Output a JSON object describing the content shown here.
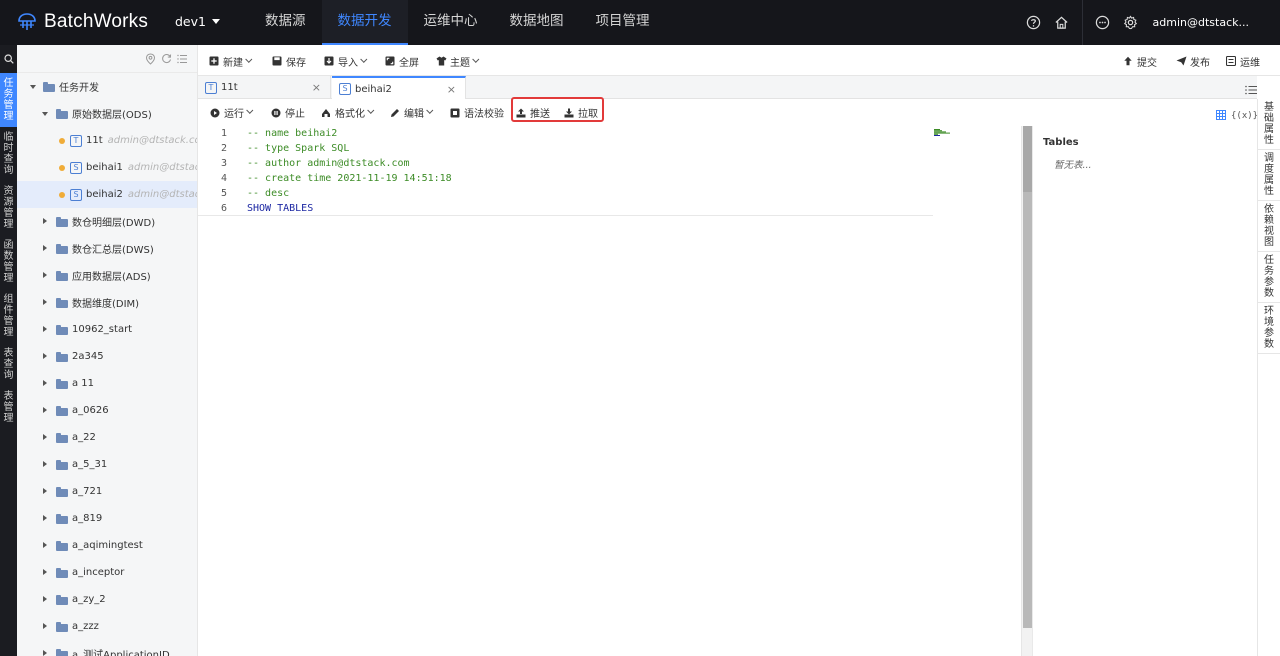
{
  "app": {
    "name": "BatchWorks",
    "project": "dev1"
  },
  "nav": [
    "数据源",
    "数据开发",
    "运维中心",
    "数据地图",
    "项目管理"
  ],
  "nav_active": "数据开发",
  "user": {
    "name": "admin@dtstack..."
  },
  "left_strip": [
    "任务管理",
    "临时查询",
    "资源管理",
    "函数管理",
    "组件管理",
    "表查询",
    "表管理"
  ],
  "tree": {
    "root": "任务开发",
    "ods_folder": "原始数据层(ODS)",
    "files": [
      {
        "type": "T",
        "name": "11t",
        "owner": "admin@dtstack.com"
      },
      {
        "type": "S",
        "name": "beihai1",
        "owner": "admin@dtstack.com"
      },
      {
        "type": "S",
        "name": "beihai2",
        "owner": "admin@dtstack.com"
      }
    ],
    "folders": [
      "数仓明细层(DWD)",
      "数仓汇总层(DWS)",
      "应用数据层(ADS)",
      "数据维度(DIM)",
      "10962_start",
      "2a345",
      "a 11",
      "a_0626",
      "a_22",
      "a_5_31",
      "a_721",
      "a_819",
      "a_aqimingtest",
      "a_inceptor",
      "a_zy_2",
      "a_zzz",
      "a_测试ApplicationID"
    ]
  },
  "main_toolbar": {
    "new": "新建",
    "save": "保存",
    "import": "导入",
    "fullscreen": "全屏",
    "theme": "主题",
    "submit": "提交",
    "publish": "发布",
    "ops": "运维"
  },
  "tabs": [
    {
      "type": "T",
      "name": "11t"
    },
    {
      "type": "S",
      "name": "beihai2"
    }
  ],
  "editor_toolbar": {
    "run": "运行",
    "stop": "停止",
    "format": "格式化",
    "edit": "编辑",
    "syntax": "语法校验",
    "push": "推送",
    "pull": "拉取",
    "vars": "{(x)}"
  },
  "code": [
    {
      "n": "1",
      "text": "-- name beihai2",
      "kind": "comment"
    },
    {
      "n": "2",
      "text": "-- type Spark SQL",
      "kind": "comment"
    },
    {
      "n": "3",
      "text": "-- author admin@dtstack.com",
      "kind": "comment"
    },
    {
      "n": "4",
      "text": "-- create time 2021-11-19 14:51:18",
      "kind": "comment"
    },
    {
      "n": "5",
      "text": "-- desc",
      "kind": "comment"
    },
    {
      "n": "6",
      "text": "SHOW TABLES",
      "kind": "keyword"
    }
  ],
  "tables_panel": {
    "title": "Tables",
    "empty": "暂无表..."
  },
  "right_strip": [
    "基础属性",
    "调度属性",
    "依赖视图",
    "任务参数",
    "环境参数"
  ],
  "colors": {
    "accent": "#3f87ff",
    "topbar": "#15161b",
    "highlight": "#e23a3a"
  }
}
